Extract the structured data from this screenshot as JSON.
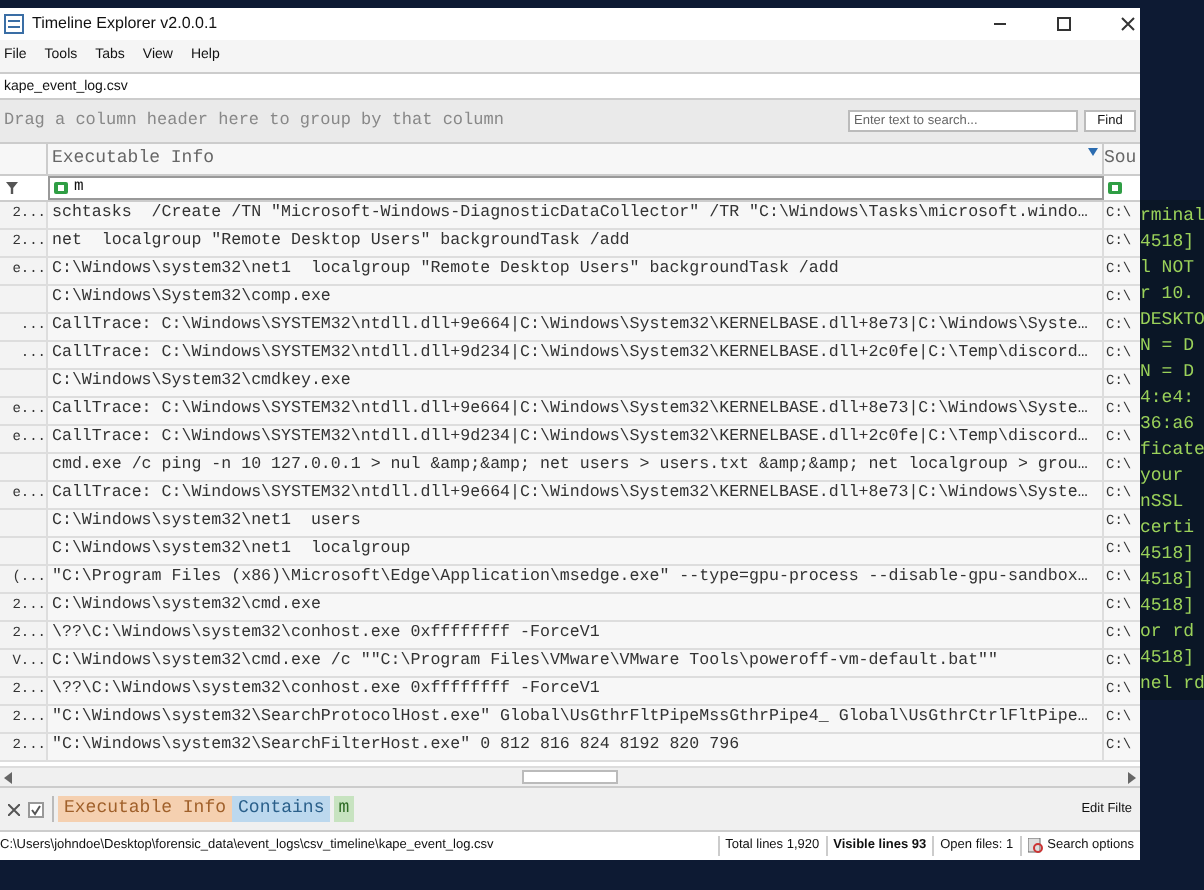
{
  "window": {
    "title": "Timeline Explorer v2.0.0.1"
  },
  "menu": [
    "File",
    "Tools",
    "Tabs",
    "View",
    "Help"
  ],
  "file_tab": {
    "label": "kape_event_log.csv",
    "selected": true
  },
  "group_panel": {
    "hint": "Drag a column header here to group by that column",
    "search": {
      "placeholder": "Enter text to search..."
    },
    "find_button": "Find"
  },
  "table": {
    "columns": [
      "Executable Info",
      "Sou"
    ],
    "filter_row": {
      "value": "m"
    },
    "rows": [
      {
        "column_1": "2...",
        "executable_info": "schtasks  /Create /TN \"Microsoft-Windows-DiagnosticDataCollector\" /TR \"C:\\Windows\\Tasks\\microsoft.windo…",
        "column_3": "C:\\"
      },
      {
        "column_1": "2...",
        "executable_info": "net  localgroup \"Remote Desktop Users\" backgroundTask /add",
        "column_3": "C:\\"
      },
      {
        "column_1": "e...",
        "executable_info": "C:\\Windows\\system32\\net1  localgroup \"Remote Desktop Users\" backgroundTask /add",
        "column_3": "C:\\"
      },
      {
        "executable_info": "C:\\Windows\\System32\\comp.exe",
        "column_3": "C:\\"
      },
      {
        "column_1": "...",
        "executable_info": "CallTrace: C:\\Windows\\SYSTEM32\\ntdll.dll+9e664|C:\\Windows\\System32\\KERNELBASE.dll+8e73|C:\\Windows\\Syste…",
        "column_3": "C:\\"
      },
      {
        "column_1": "...",
        "executable_info": "CallTrace: C:\\Windows\\SYSTEM32\\ntdll.dll+9d234|C:\\Windows\\System32\\KERNELBASE.dll+2c0fe|C:\\Temp\\discord…",
        "column_3": "C:\\"
      },
      {
        "executable_info": "C:\\Windows\\System32\\cmdkey.exe",
        "column_3": "C:\\"
      },
      {
        "column_1": "e...",
        "executable_info": "CallTrace: C:\\Windows\\SYSTEM32\\ntdll.dll+9e664|C:\\Windows\\System32\\KERNELBASE.dll+8e73|C:\\Windows\\Syste…",
        "column_3": "C:\\"
      },
      {
        "column_1": "e...",
        "executable_info": "CallTrace: C:\\Windows\\SYSTEM32\\ntdll.dll+9d234|C:\\Windows\\System32\\KERNELBASE.dll+2c0fe|C:\\Temp\\discord…",
        "column_3": "C:\\"
      },
      {
        "executable_info": "cmd.exe /c ping -n 10 127.0.0.1 > nul &amp;&amp; net users > users.txt &amp;&amp; net localgroup > grou…",
        "column_3": "C:\\"
      },
      {
        "column_1": "e...",
        "executable_info": "CallTrace: C:\\Windows\\SYSTEM32\\ntdll.dll+9e664|C:\\Windows\\System32\\KERNELBASE.dll+8e73|C:\\Windows\\Syste…",
        "column_3": "C:\\"
      },
      {
        "executable_info": "C:\\Windows\\system32\\net1  users",
        "column_3": "C:\\"
      },
      {
        "executable_info": "C:\\Windows\\system32\\net1  localgroup",
        "column_3": "C:\\"
      },
      {
        "column_1": "(...",
        "executable_info": "\"C:\\Program Files (x86)\\Microsoft\\Edge\\Application\\msedge.exe\" --type=gpu-process --disable-gpu-sandbox…",
        "column_3": "C:\\"
      },
      {
        "column_1": "2...",
        "executable_info": "C:\\Windows\\system32\\cmd.exe",
        "column_3": "C:\\"
      },
      {
        "column_1": "2...",
        "executable_info": "\\??\\C:\\Windows\\system32\\conhost.exe 0xffffffff -ForceV1",
        "column_3": "C:\\"
      },
      {
        "column_1": "V...",
        "executable_info": "C:\\Windows\\system32\\cmd.exe /c \"\"C:\\Program Files\\VMware\\VMware Tools\\poweroff-vm-default.bat\"\"",
        "column_3": "C:\\"
      },
      {
        "column_1": "2...",
        "executable_info": "\\??\\C:\\Windows\\system32\\conhost.exe 0xffffffff -ForceV1",
        "column_3": "C:\\"
      },
      {
        "column_1": "2...",
        "executable_info": "\"C:\\Windows\\system32\\SearchProtocolHost.exe\" Global\\UsGthrFltPipeMssGthrPipe4_ Global\\UsGthrCtrlFltPipe…",
        "column_3": "C:\\"
      },
      {
        "column_1": "2...",
        "executable_info": "\"C:\\Windows\\system32\\SearchFilterHost.exe\" 0 812 816 824 8192 820 796",
        "column_3": "C:\\"
      }
    ]
  },
  "filter_bar": {
    "enabled": true,
    "column": "Executable Info",
    "operator": "Contains",
    "value": "m",
    "edit_filter": "Edit Filte"
  },
  "status_bar": {
    "path": "C:\\Users\\johndoe\\Desktop\\forensic_data\\event_logs\\csv_timeline\\kape_event_log.csv",
    "total_lines": "Total lines 1,920",
    "visible_lines": "Visible lines 93",
    "open_files": "Open files: 1",
    "search_options": "Search options"
  },
  "terminal_lines": [
    "rminal",
    "4518]",
    "l NOT",
    "r 10.",
    "DESKTO",
    "N = D",
    "N = D",
    "4:e4:",
    "36:a6",
    "ficate",
    "your",
    "nSSL",
    "certi",
    "4518]",
    "4518]",
    "4518]",
    "or rd",
    "4518]",
    "nel rd"
  ]
}
